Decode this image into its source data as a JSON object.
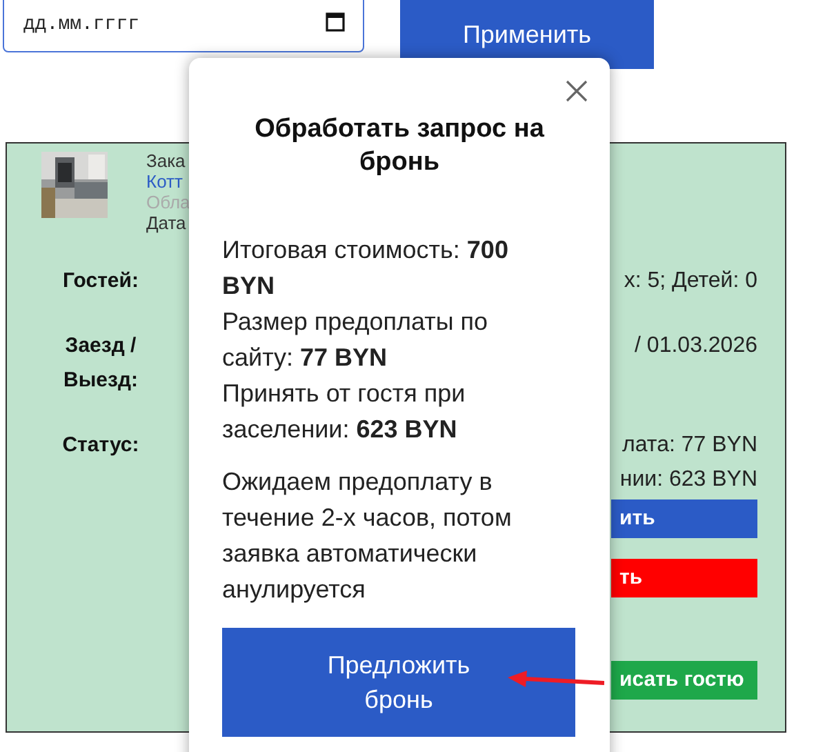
{
  "date_filter": {
    "placeholder": "дд.мм.гггг"
  },
  "apply_button": "Применить",
  "booking": {
    "info_lines": [
      {
        "text": "Зака",
        "kind": "plain"
      },
      {
        "text": "Котт",
        "kind": "link"
      },
      {
        "text": "Обла",
        "kind": "muted"
      },
      {
        "text": "Дата",
        "kind": "plain"
      }
    ],
    "rows": [
      {
        "label": "Гостей:",
        "values": [
          "х: 5; Детей: 0"
        ]
      },
      {
        "label": "Заезд / Выезд:",
        "values": [
          "/ 01.03.2026"
        ]
      },
      {
        "label": "Статус:",
        "values": [
          "лата: 77 BYN",
          "нии: 623 BYN"
        ]
      }
    ],
    "buttons": [
      {
        "label": "ить",
        "color": "#2b5bc6"
      },
      {
        "label": "ть",
        "color": "#ff0000"
      },
      {
        "label": "исать гостю",
        "color": "#1ea84a"
      }
    ]
  },
  "dialog": {
    "title": "Обработать запрос на бронь",
    "summary": [
      "Итоговая стоимость: **700 BYN**",
      "Размер предоплаты по сайту: **77 BYN**",
      "Принять от гостя при заселении: **623 BYN**"
    ],
    "note": "Ожидаем предоплату в течение 2-х часов, потом заявка автоматически анулируется",
    "confirm_button": "Предложить бронь"
  }
}
